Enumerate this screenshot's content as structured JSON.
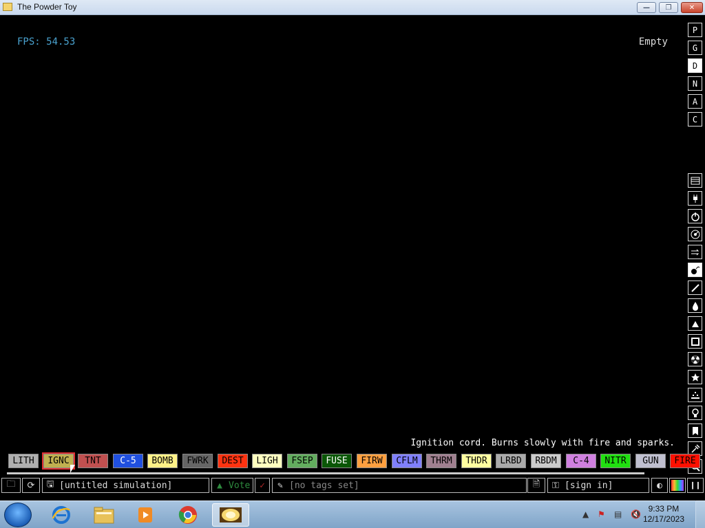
{
  "window": {
    "title": "The Powder Toy"
  },
  "hud": {
    "fps": "FPS: 54.53",
    "status": "Empty",
    "description": "Ignition cord. Burns slowly with fire and sparks."
  },
  "quick_options": [
    {
      "label": "P",
      "active": false
    },
    {
      "label": "G",
      "active": false
    },
    {
      "label": "D",
      "active": true
    },
    {
      "label": "N",
      "active": false
    },
    {
      "label": "A",
      "active": false
    },
    {
      "label": "C",
      "active": false
    }
  ],
  "categories": [
    {
      "icon": "walls-icon"
    },
    {
      "icon": "electronics-icon"
    },
    {
      "icon": "powered-icon"
    },
    {
      "icon": "sensors-icon"
    },
    {
      "icon": "force-icon"
    },
    {
      "icon": "explosives-icon",
      "active": true
    },
    {
      "icon": "gases-icon"
    },
    {
      "icon": "liquids-icon"
    },
    {
      "icon": "powders-icon"
    },
    {
      "icon": "solids-icon"
    },
    {
      "icon": "radioactive-icon"
    },
    {
      "icon": "special-icon"
    },
    {
      "icon": "life-icon"
    },
    {
      "icon": "tools-icon"
    },
    {
      "icon": "favorites-icon"
    },
    {
      "icon": "decoration-icon"
    },
    {
      "icon": "search-icon"
    }
  ],
  "elements": [
    {
      "label": "LITH",
      "bg": "#b0b0b0",
      "fg": "#000000"
    },
    {
      "label": "IGNC",
      "bg": "#c0b050",
      "fg": "#000000",
      "selected": true
    },
    {
      "label": "TNT",
      "bg": "#c05050",
      "fg": "#000000"
    },
    {
      "label": "C-5",
      "bg": "#2050e0",
      "fg": "#ffffff"
    },
    {
      "label": "BOMB",
      "bg": "#fff288",
      "fg": "#000000"
    },
    {
      "label": "FWRK",
      "bg": "#666666",
      "fg": "#000000"
    },
    {
      "label": "DEST",
      "bg": "#ff3311",
      "fg": "#000000"
    },
    {
      "label": "LIGH",
      "bg": "#ffffc0",
      "fg": "#000000"
    },
    {
      "label": "FSEP",
      "bg": "#63ad5f",
      "fg": "#000000"
    },
    {
      "label": "FUSE",
      "bg": "#0a5706",
      "fg": "#ffffff"
    },
    {
      "label": "FIRW",
      "bg": "#ffa040",
      "fg": "#000000"
    },
    {
      "label": "CFLM",
      "bg": "#8080ff",
      "fg": "#000000"
    },
    {
      "label": "THRM",
      "bg": "#a08090",
      "fg": "#000000"
    },
    {
      "label": "THDR",
      "bg": "#ffffa0",
      "fg": "#000000"
    },
    {
      "label": "LRBD",
      "bg": "#aaaaaa",
      "fg": "#000000"
    },
    {
      "label": "RBDM",
      "bg": "#cccccc",
      "fg": "#000000"
    },
    {
      "label": "C-4",
      "bg": "#d080e0",
      "fg": "#000000"
    },
    {
      "label": "NITR",
      "bg": "#20e010",
      "fg": "#000000"
    },
    {
      "label": "GUN",
      "bg": "#c0c0d0",
      "fg": "#000000"
    },
    {
      "label": "FIRE",
      "bg": "#ff1000",
      "fg": "#000000"
    }
  ],
  "toolbar": {
    "save_name": "[untitled simulation]",
    "vote_label": "Vote",
    "tags": "[no tags set]",
    "sign_in": "[sign in]"
  },
  "taskbar": {
    "time": "9:33 PM",
    "date": "12/17/2023",
    "apps": [
      "internet-explorer-icon",
      "file-explorer-icon",
      "media-player-icon",
      "chrome-icon",
      "powder-toy-icon"
    ]
  }
}
